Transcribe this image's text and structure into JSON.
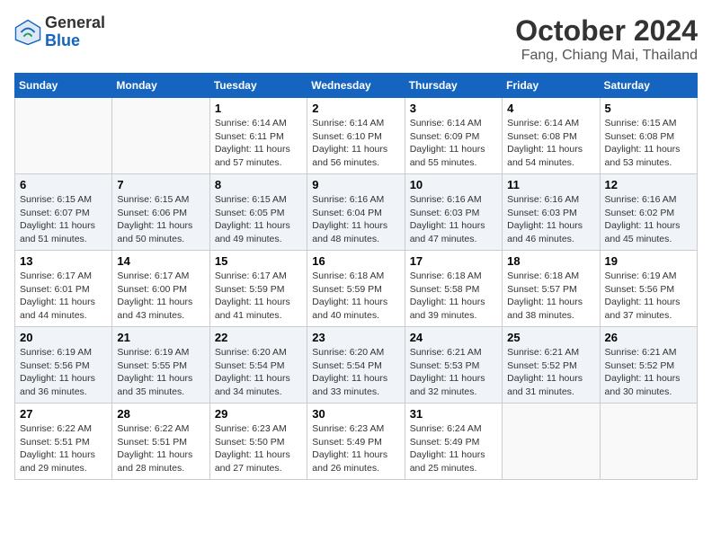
{
  "header": {
    "logo_general": "General",
    "logo_blue": "Blue",
    "month": "October 2024",
    "location": "Fang, Chiang Mai, Thailand"
  },
  "weekdays": [
    "Sunday",
    "Monday",
    "Tuesday",
    "Wednesday",
    "Thursday",
    "Friday",
    "Saturday"
  ],
  "weeks": [
    [
      {
        "day": "",
        "info": ""
      },
      {
        "day": "",
        "info": ""
      },
      {
        "day": "1",
        "info": "Sunrise: 6:14 AM\nSunset: 6:11 PM\nDaylight: 11 hours and 57 minutes."
      },
      {
        "day": "2",
        "info": "Sunrise: 6:14 AM\nSunset: 6:10 PM\nDaylight: 11 hours and 56 minutes."
      },
      {
        "day": "3",
        "info": "Sunrise: 6:14 AM\nSunset: 6:09 PM\nDaylight: 11 hours and 55 minutes."
      },
      {
        "day": "4",
        "info": "Sunrise: 6:14 AM\nSunset: 6:08 PM\nDaylight: 11 hours and 54 minutes."
      },
      {
        "day": "5",
        "info": "Sunrise: 6:15 AM\nSunset: 6:08 PM\nDaylight: 11 hours and 53 minutes."
      }
    ],
    [
      {
        "day": "6",
        "info": "Sunrise: 6:15 AM\nSunset: 6:07 PM\nDaylight: 11 hours and 51 minutes."
      },
      {
        "day": "7",
        "info": "Sunrise: 6:15 AM\nSunset: 6:06 PM\nDaylight: 11 hours and 50 minutes."
      },
      {
        "day": "8",
        "info": "Sunrise: 6:15 AM\nSunset: 6:05 PM\nDaylight: 11 hours and 49 minutes."
      },
      {
        "day": "9",
        "info": "Sunrise: 6:16 AM\nSunset: 6:04 PM\nDaylight: 11 hours and 48 minutes."
      },
      {
        "day": "10",
        "info": "Sunrise: 6:16 AM\nSunset: 6:03 PM\nDaylight: 11 hours and 47 minutes."
      },
      {
        "day": "11",
        "info": "Sunrise: 6:16 AM\nSunset: 6:03 PM\nDaylight: 11 hours and 46 minutes."
      },
      {
        "day": "12",
        "info": "Sunrise: 6:16 AM\nSunset: 6:02 PM\nDaylight: 11 hours and 45 minutes."
      }
    ],
    [
      {
        "day": "13",
        "info": "Sunrise: 6:17 AM\nSunset: 6:01 PM\nDaylight: 11 hours and 44 minutes."
      },
      {
        "day": "14",
        "info": "Sunrise: 6:17 AM\nSunset: 6:00 PM\nDaylight: 11 hours and 43 minutes."
      },
      {
        "day": "15",
        "info": "Sunrise: 6:17 AM\nSunset: 5:59 PM\nDaylight: 11 hours and 41 minutes."
      },
      {
        "day": "16",
        "info": "Sunrise: 6:18 AM\nSunset: 5:59 PM\nDaylight: 11 hours and 40 minutes."
      },
      {
        "day": "17",
        "info": "Sunrise: 6:18 AM\nSunset: 5:58 PM\nDaylight: 11 hours and 39 minutes."
      },
      {
        "day": "18",
        "info": "Sunrise: 6:18 AM\nSunset: 5:57 PM\nDaylight: 11 hours and 38 minutes."
      },
      {
        "day": "19",
        "info": "Sunrise: 6:19 AM\nSunset: 5:56 PM\nDaylight: 11 hours and 37 minutes."
      }
    ],
    [
      {
        "day": "20",
        "info": "Sunrise: 6:19 AM\nSunset: 5:56 PM\nDaylight: 11 hours and 36 minutes."
      },
      {
        "day": "21",
        "info": "Sunrise: 6:19 AM\nSunset: 5:55 PM\nDaylight: 11 hours and 35 minutes."
      },
      {
        "day": "22",
        "info": "Sunrise: 6:20 AM\nSunset: 5:54 PM\nDaylight: 11 hours and 34 minutes."
      },
      {
        "day": "23",
        "info": "Sunrise: 6:20 AM\nSunset: 5:54 PM\nDaylight: 11 hours and 33 minutes."
      },
      {
        "day": "24",
        "info": "Sunrise: 6:21 AM\nSunset: 5:53 PM\nDaylight: 11 hours and 32 minutes."
      },
      {
        "day": "25",
        "info": "Sunrise: 6:21 AM\nSunset: 5:52 PM\nDaylight: 11 hours and 31 minutes."
      },
      {
        "day": "26",
        "info": "Sunrise: 6:21 AM\nSunset: 5:52 PM\nDaylight: 11 hours and 30 minutes."
      }
    ],
    [
      {
        "day": "27",
        "info": "Sunrise: 6:22 AM\nSunset: 5:51 PM\nDaylight: 11 hours and 29 minutes."
      },
      {
        "day": "28",
        "info": "Sunrise: 6:22 AM\nSunset: 5:51 PM\nDaylight: 11 hours and 28 minutes."
      },
      {
        "day": "29",
        "info": "Sunrise: 6:23 AM\nSunset: 5:50 PM\nDaylight: 11 hours and 27 minutes."
      },
      {
        "day": "30",
        "info": "Sunrise: 6:23 AM\nSunset: 5:49 PM\nDaylight: 11 hours and 26 minutes."
      },
      {
        "day": "31",
        "info": "Sunrise: 6:24 AM\nSunset: 5:49 PM\nDaylight: 11 hours and 25 minutes."
      },
      {
        "day": "",
        "info": ""
      },
      {
        "day": "",
        "info": ""
      }
    ]
  ]
}
